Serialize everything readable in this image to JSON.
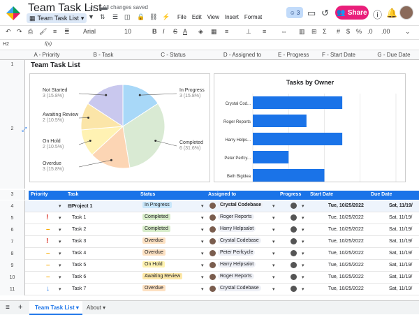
{
  "app": {
    "title": "Team Task List",
    "saved": "All changes saved",
    "sheet_chip": "Team Task List",
    "menus": [
      "File",
      "Edit",
      "View",
      "Insert",
      "Format"
    ],
    "collab_count": "3",
    "share_label": "Share"
  },
  "toolbar": {
    "font": "Arial",
    "size": "10",
    "cellref": "H2",
    "fx": "f(x)"
  },
  "columns": [
    "A - Priority",
    "B - Task",
    "C - Status",
    "D - Assigned to",
    "E - Progress",
    "F - Start Date",
    "G - Due Date"
  ],
  "rows": [
    "1",
    "2",
    "3",
    "4",
    "5",
    "6",
    "7",
    "8",
    "9",
    "10",
    "11"
  ],
  "sheet_title": "Team Task List",
  "pie": {
    "slices": [
      {
        "label": "In Progress",
        "sub": "3 (15.8%)",
        "value": 3,
        "color": "#a8d8f8"
      },
      {
        "label": "Completed",
        "sub": "6 (31.6%)",
        "value": 6,
        "color": "#d9ead3"
      },
      {
        "label": "Overdue",
        "sub": "3 (15.8%)",
        "value": 3,
        "color": "#fcd5b4"
      },
      {
        "label": "On Hold",
        "sub": "2 (10.5%)",
        "value": 2,
        "color": "#fff2b3"
      },
      {
        "label": "Awaiting Review",
        "sub": "2 (10.5%)",
        "value": 2,
        "color": "#fbe5a8"
      },
      {
        "label": "Not Started",
        "sub": "3 (15.8%)",
        "value": 3,
        "color": "#c9c8ee"
      }
    ]
  },
  "chart_data": [
    {
      "type": "pie",
      "categories": [
        "In Progress",
        "Completed",
        "Overdue",
        "On Hold",
        "Awaiting Review",
        "Not Started"
      ],
      "values": [
        3,
        6,
        3,
        2,
        2,
        3
      ]
    },
    {
      "type": "bar",
      "title": "Tasks by Owner",
      "categories": [
        "Crystal Cod...",
        "Roger Reports",
        "Harry Helps...",
        "Peter Perfcy...",
        "Beth Bigidea"
      ],
      "values": [
        5,
        3,
        5,
        2,
        4
      ],
      "xlim": [
        0,
        8
      ],
      "ticks": [
        "0",
        "2",
        "4",
        "6",
        "8"
      ]
    }
  ],
  "table": {
    "headers": [
      "Priority",
      "Task",
      "Status",
      "Assigned to",
      "Progress",
      "Start Date",
      "Due Date"
    ],
    "rows": [
      {
        "row": "4",
        "pri": "",
        "task": "Project 1",
        "status": "In Progress",
        "assignee": "Crystal Codebase",
        "start": "Tue, 10/25/2022",
        "due": "Sat, 11/19/"
      },
      {
        "row": "5",
        "pri": "!",
        "task": "Task 1",
        "status": "Completed",
        "assignee": "Roger Reports",
        "start": "Tue, 10/25/2022",
        "due": "Sat, 11/19/"
      },
      {
        "row": "6",
        "pri": "–",
        "task": "Task 2",
        "status": "Completed",
        "assignee": "Harry Helpsalot",
        "start": "Tue, 10/25/2022",
        "due": "Sat, 11/19/"
      },
      {
        "row": "7",
        "pri": "!",
        "task": "Task 3",
        "status": "Overdue",
        "assignee": "Crystal Codebase",
        "start": "Tue, 10/25/2022",
        "due": "Sat, 11/19/"
      },
      {
        "row": "8",
        "pri": "–",
        "task": "Task 4",
        "status": "Overdue",
        "assignee": "Peter Perfcycle",
        "start": "Tue, 10/25/2022",
        "due": "Sat, 11/19/"
      },
      {
        "row": "9",
        "pri": "–",
        "task": "Task 5",
        "status": "On Hold",
        "assignee": "Harry Helpsalot",
        "start": "Tue, 10/25/2022",
        "due": "Sat, 11/19/"
      },
      {
        "row": "10",
        "pri": "–",
        "task": "Task 6",
        "status": "Awaiting Review",
        "assignee": "Roger Reports",
        "start": "Tue, 10/25/2022",
        "due": "Sat, 11/19/"
      },
      {
        "row": "11",
        "pri": "↓",
        "task": "Task 7",
        "status": "Overdue",
        "assignee": "Crystal Codebase",
        "start": "Tue, 10/25/2022",
        "due": "Sat, 11/19/"
      }
    ]
  },
  "status_colors": {
    "In Progress": "#c9e7fb",
    "Completed": "#d7ecc9",
    "Overdue": "#fde1c2",
    "On Hold": "#fff3b0",
    "Awaiting Review": "#fde8a8"
  },
  "tabs": [
    "Team Task List",
    "About"
  ]
}
